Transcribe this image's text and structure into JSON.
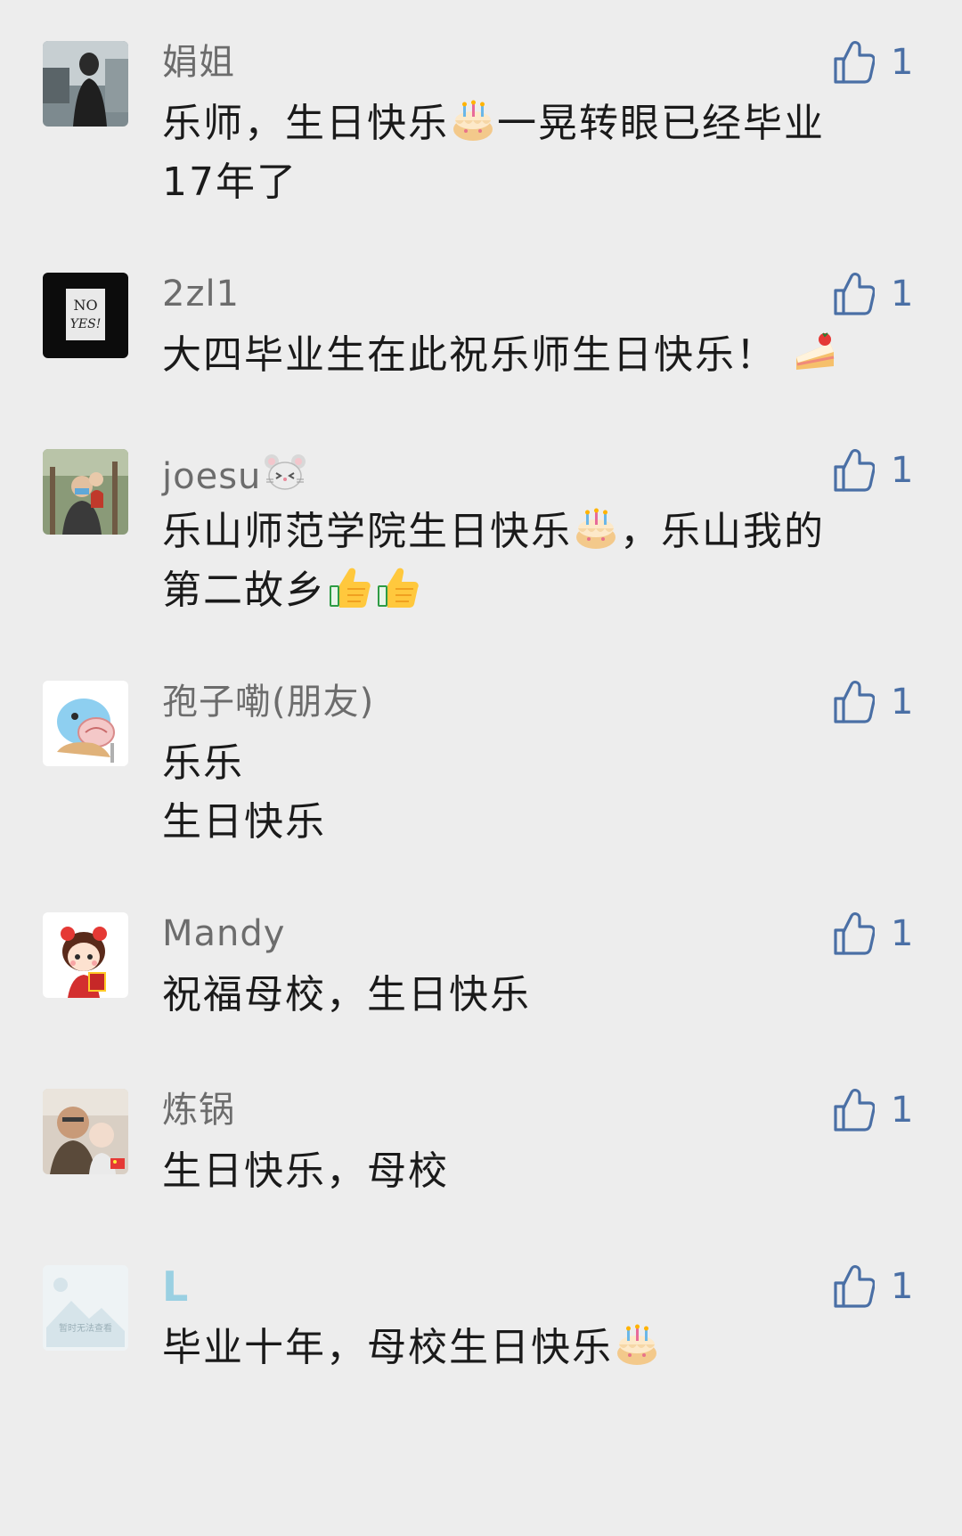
{
  "comments": [
    {
      "name": "娟姐",
      "likes": "1",
      "text_a": "乐师，生日快乐",
      "emoji_a": "birthday-cake",
      "text_b": "一晃转眼已经毕业\n17年了"
    },
    {
      "name": "2zl1",
      "likes": "1",
      "text_a": "大四毕业生在此祝乐师生日快乐！ ",
      "emoji_a": "cake-slice",
      "avatar_text_1": "NO",
      "avatar_text_2": "YES!"
    },
    {
      "name": "joesu",
      "name_emoji": "mouse-face",
      "likes": "1",
      "text_a": "乐山师范学院生日快乐",
      "emoji_a": "birthday-cake",
      "text_b": "，乐山我的\n第二故乡",
      "emoji_b": "thumbs-up",
      "emoji_c": "thumbs-up"
    },
    {
      "name": "孢子嘞(朋友)",
      "likes": "1",
      "text_a": "乐乐\n生日快乐"
    },
    {
      "name": "Mandy",
      "likes": "1",
      "text_a": "祝福母校，生日快乐"
    },
    {
      "name": "炼锅",
      "likes": "1",
      "text_a": "生日快乐，母校"
    },
    {
      "name": "L",
      "likes": "1",
      "text_a": "毕业十年，母校生日快乐",
      "emoji_a": "birthday-cake",
      "avatar_caption": "暂时无法查看"
    }
  ],
  "colors": {
    "background": "#ededed",
    "name": "#6c6c6c",
    "like": "#4a6fa5",
    "text": "#1a1a1a"
  }
}
